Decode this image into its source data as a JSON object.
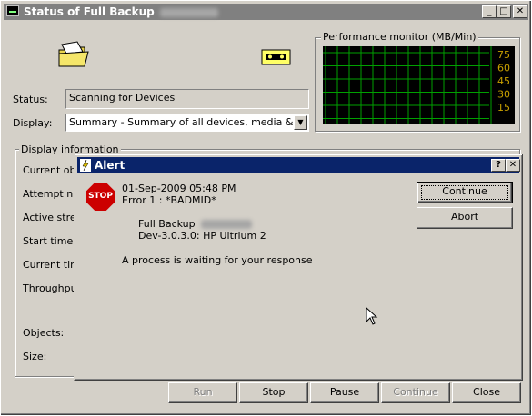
{
  "window": {
    "title": "Status of Full Backup",
    "title_buttons": {
      "minimize": "_",
      "maximize": "□",
      "close": "✕"
    }
  },
  "header": {
    "status_label": "Status:",
    "status_value": "Scanning for Devices",
    "display_label": "Display:",
    "display_value": "Summary - Summary of all devices, media & streams"
  },
  "performance": {
    "title": "Performance monitor (MB/Min)",
    "scale": [
      "75",
      "60",
      "45",
      "30",
      "15"
    ],
    "grid_color": "#00a000",
    "label_color": "#c8a000"
  },
  "display_info": {
    "title": "Display information",
    "labels": [
      "Current obje",
      "Attempt nur",
      "Active strea",
      "Start time:",
      "Current time",
      "Throughput",
      "Objects:",
      "Size:"
    ]
  },
  "buttons": {
    "run": "Run",
    "stop": "Stop",
    "pause": "Pause",
    "continue": "Continue",
    "close": "Close"
  },
  "alert": {
    "title": "Alert",
    "help_btn": "?",
    "close_btn": "✕",
    "stop_icon_text": "STOP",
    "timestamp": "01-Sep-2009 05:48 PM",
    "error": "Error 1 : *BADMID*",
    "job": "Full Backup",
    "device": "Dev-3.0.3.0: HP Ultrium 2",
    "message": "A process is waiting for your response",
    "continue_label": "Continue",
    "abort_label": "Abort"
  }
}
